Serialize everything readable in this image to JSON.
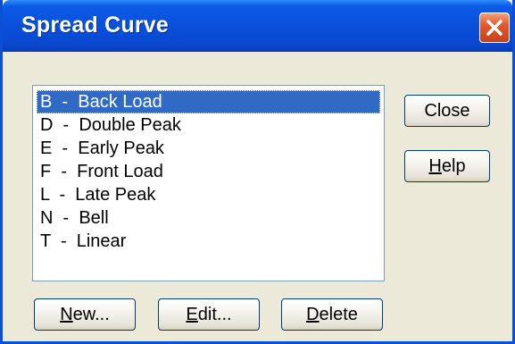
{
  "window": {
    "title": "Spread Curve"
  },
  "list": {
    "items": [
      {
        "label": "B  -  Back Load",
        "selected": true
      },
      {
        "label": "D  -  Double Peak",
        "selected": false
      },
      {
        "label": "E  -  Early Peak",
        "selected": false
      },
      {
        "label": "F  -  Front Load",
        "selected": false
      },
      {
        "label": "L  -  Late Peak",
        "selected": false
      },
      {
        "label": "N  -  Bell",
        "selected": false
      },
      {
        "label": "T  -  Linear",
        "selected": false
      }
    ]
  },
  "buttons": {
    "close": "Close",
    "help_first": "H",
    "help_rest": "elp",
    "new_first": "N",
    "new_rest": "ew...",
    "edit_first": "E",
    "edit_rest": "dit...",
    "delete_first": "D",
    "delete_rest": "elete"
  },
  "icons": {
    "close": "close-icon"
  },
  "colors": {
    "titlebar": "#0a51dc",
    "selection": "#316ac5",
    "close_button": "#e25a2f",
    "background": "#ece9d8"
  }
}
